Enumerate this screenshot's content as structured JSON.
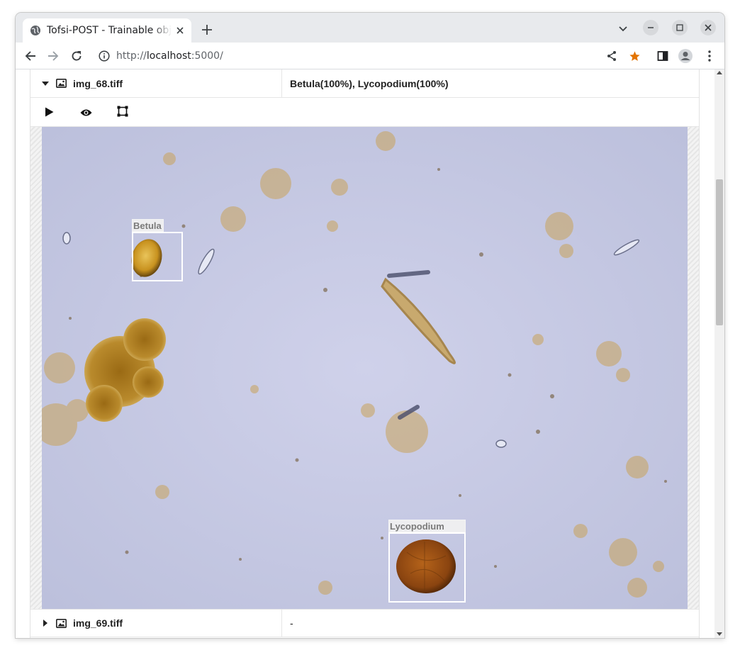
{
  "browser": {
    "tab_title": "Tofsi-POST - Trainable object detection",
    "url_prefix": "http://",
    "url_host": "localhost",
    "url_suffix": ":5000/",
    "icons": {
      "favicon": "globe-icon",
      "tab_close": "close-icon",
      "new_tab": "plus-icon",
      "back": "arrow-left-icon",
      "forward": "arrow-right-icon",
      "reload": "reload-icon",
      "site_info": "info-icon",
      "share": "share-icon",
      "bookmark": "star-icon",
      "side_panel": "side-panel-icon",
      "profile": "person-icon",
      "menu": "kebab-menu-icon"
    },
    "colors": {
      "bookmark_star": "#e37400"
    }
  },
  "table": {
    "rows": [
      {
        "filename": "img_68.tiff",
        "result": "Betula(100%), Lycopodium(100%)",
        "expanded": true
      },
      {
        "filename": "img_69.tiff",
        "result": "-",
        "expanded": false
      }
    ],
    "actions": [
      {
        "name": "play-button",
        "icon": "play-icon"
      },
      {
        "name": "view-button",
        "icon": "eye-icon"
      },
      {
        "name": "bounding-box-button",
        "icon": "bounding-box-icon"
      }
    ]
  },
  "image_viewer": {
    "detections": [
      {
        "label": "Betula"
      },
      {
        "label": "Lycopodium"
      }
    ]
  }
}
